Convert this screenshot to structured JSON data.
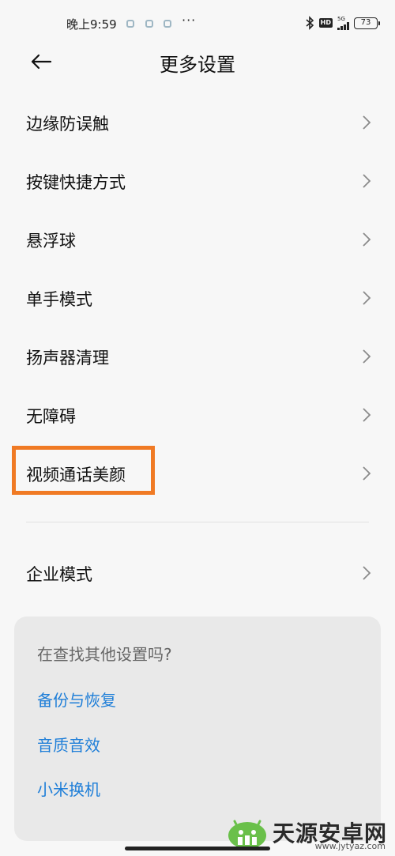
{
  "status_bar": {
    "time": "晚上9:59",
    "more": "···",
    "hd": "HD",
    "network": "5G",
    "battery": "73"
  },
  "header": {
    "back_icon": "arrow-left-icon",
    "title": "更多设置"
  },
  "settings": [
    {
      "label": "边缘防误触"
    },
    {
      "label": "按键快捷方式"
    },
    {
      "label": "悬浮球"
    },
    {
      "label": "单手模式"
    },
    {
      "label": "扬声器清理"
    },
    {
      "label": "无障碍"
    },
    {
      "label": "视频通话美颜"
    },
    {
      "label": "企业模式"
    }
  ],
  "help": {
    "title": "在查找其他设置吗?",
    "links": [
      "备份与恢复",
      "音质音效",
      "小米换机"
    ],
    "link_color": "#1e7ed8"
  },
  "highlight_color": "#f07a24",
  "watermark": {
    "text": "天源安卓网",
    "url": "www.jytyaz.com"
  }
}
